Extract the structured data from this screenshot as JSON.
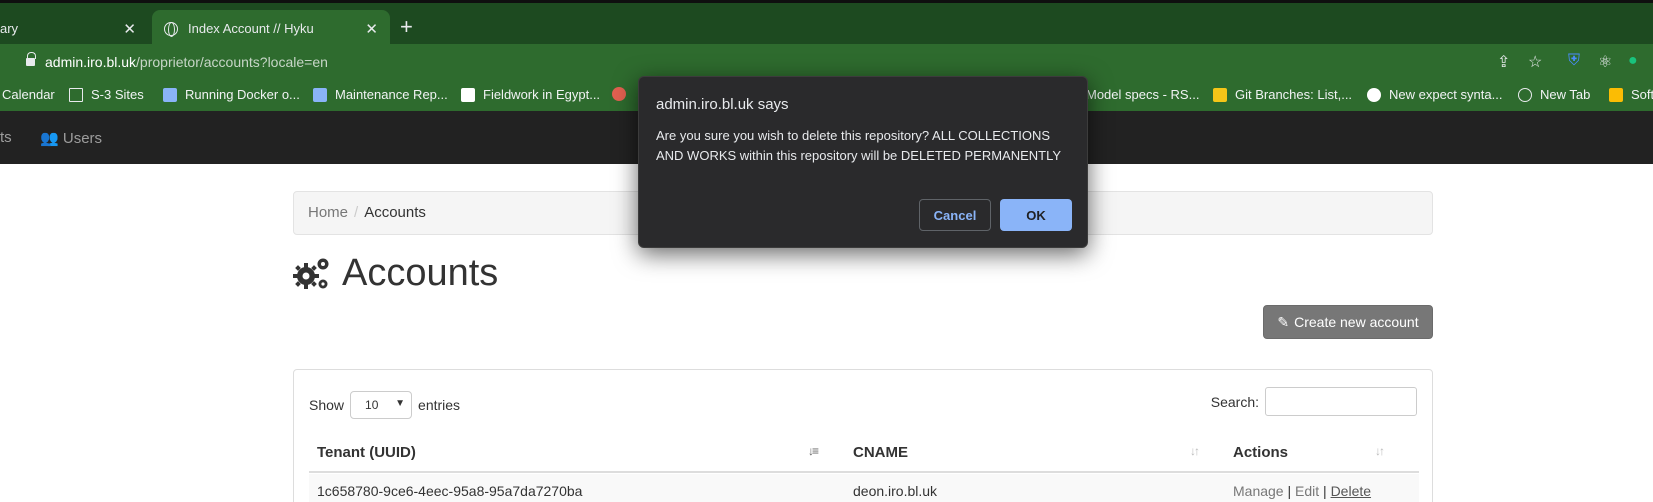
{
  "browser": {
    "tabs": [
      {
        "label": "ary",
        "active": false
      },
      {
        "label": "Index Account // Hyku",
        "active": true
      }
    ],
    "new_tab": "+",
    "url": {
      "host": "admin.iro.bl.uk",
      "path": "/proprietor/accounts?locale=en"
    },
    "bookmarks": [
      "Calendar",
      "S-3 Sites",
      "Running Docker o...",
      "Maintenance Rep...",
      "Fieldwork in Egypt...",
      "Model specs - RS...",
      "Git Branches: List,...",
      "New expect synta...",
      "New Tab",
      "Soft"
    ]
  },
  "appnav": {
    "items": [
      "ts",
      "Users"
    ]
  },
  "breadcrumb": {
    "home": "Home",
    "separator": "/",
    "current": "Accounts"
  },
  "page": {
    "title": "Accounts",
    "create_button": "Create new account"
  },
  "table": {
    "show_label": "Show",
    "entries_label": "entries",
    "page_size": "10",
    "search_label": "Search:",
    "search_value": "",
    "columns": [
      "Tenant (UUID)",
      "CNAME",
      "Actions"
    ],
    "rows": [
      {
        "tenant": "1c658780-9ce6-4eec-95a8-95a7da7270ba",
        "cname": "deon.iro.bl.uk",
        "manage": "Manage",
        "edit": "Edit",
        "delete": "Delete",
        "sep": "|"
      }
    ]
  },
  "dialog": {
    "title": "admin.iro.bl.uk says",
    "message": "Are you sure you wish to delete this repository? ALL COLLECTIONS AND WORKS within this repository will be DELETED PERMANENTLY",
    "cancel": "Cancel",
    "ok": "OK"
  },
  "colors": {
    "chrome": "#2e6b2e",
    "navbar": "#222222",
    "dialog_bg": "#2a2a2c",
    "ok_button": "#8ab4f8"
  }
}
